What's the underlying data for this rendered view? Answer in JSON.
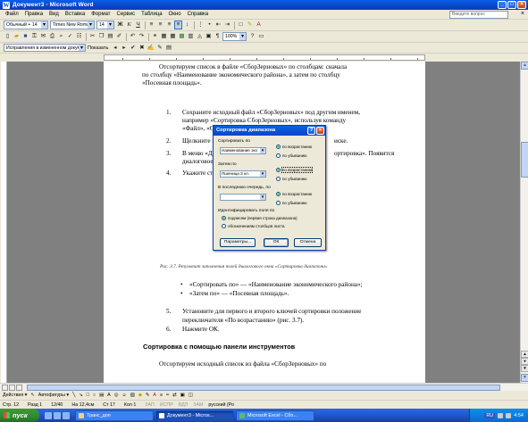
{
  "window": {
    "title": "Документ3 - Microsoft Word",
    "app_icon": "W",
    "minimize": "_",
    "maximize": "□",
    "close": "×"
  },
  "menu": {
    "items": [
      "Файл",
      "Правка",
      "Вид",
      "Вставка",
      "Формат",
      "Сервис",
      "Таблица",
      "Окно",
      "Справка"
    ],
    "help_placeholder": "Введите вопрос",
    "doc_close": "×"
  },
  "toolbar_format": {
    "style": "Обычный + 14",
    "font": "Times New Roman",
    "size": "14",
    "bold": "Ж",
    "italic": "К",
    "underline": "Ч",
    "zoom": "100%"
  },
  "toolbar_review": {
    "mode": "Исправления в измененном документе",
    "show": "Показать"
  },
  "document": {
    "p1_line1": "Отсортируем список в файле «СборЗерновых» по столбцам: сначала",
    "p1_line2": "по столбцу «Наименование экономического района», а затем по столбцу",
    "p1_line3": "«Посевная площадь».",
    "item1_num": "1.",
    "item1_line1": "Сохраните исходный файл «СборЗерновых» под другим именем,",
    "item1_line2": "например «Сортировка СборЗерновых», используя команду",
    "item1_line3": "«Файл», «Со",
    "item2_num": "2.",
    "item2_text": "Щелкните по",
    "item2_tail": "иске.",
    "item3_num": "3.",
    "item3_line1": "В меню «Д",
    "item3_tail": "ортировка». Появится",
    "item3_line2": "диалоговое о",
    "item4_num": "4.",
    "item4_text": "Укажите столб",
    "caption": "Рис. 3.7. Результат заполнения полей диалогового окна «Сортировка диапазона»",
    "bullet1": "«Сортировать по» — «Наименование экономического района»;",
    "bullet2": "«Затем по» — «Посевная площадь».",
    "item5_num": "5.",
    "item5_line1": "Установите для первого и второго ключей сортировки положение",
    "item5_line2": "переключателя «По возрастанию» (рис. 3.7).",
    "item6_num": "6.",
    "item6_text": "Нажмите ОК.",
    "heading": "Сортировка с помощью панели инструментов",
    "p2": "Отсортируем исходный список из файла «СборЗерновых» по"
  },
  "dialog": {
    "title": "Сортировка диапазона",
    "sort_by_label": "Сортировать по",
    "sort_by_value": "Наименование эко",
    "then_by_label": "Затем по",
    "then_by_value": "Пшеница 3 кл.",
    "last_label": "В последнюю очередь, по",
    "last_value": "",
    "asc": "по возрастанию",
    "desc": "по убыванию",
    "identify_label": "Идентифицировать поля по",
    "opt_headers": "подписям (первая строка диапазона)",
    "opt_columns": "обозначениям столбцов листа",
    "btn_params": "Параметры...",
    "btn_ok": "ОК",
    "btn_cancel": "Отмена",
    "help": "?",
    "close": "×"
  },
  "drawbar": {
    "actions": "Действия ▾",
    "autoshapes": "Автофигуры ▾"
  },
  "status": {
    "page": "Стр. 12",
    "section": "Разд 1",
    "pages": "12/40",
    "at": "На 12,4см",
    "line": "Ст 17",
    "col": "Кол 1",
    "rec": "ЗАП",
    "trk": "ИСПР",
    "ext": "ВДЛ",
    "ovr": "ЗАМ",
    "lang": "русский (Ро"
  },
  "taskbar": {
    "start": "пуск",
    "tasks": [
      "Транс_доп",
      "Документ3 - Micros...",
      "Microsoft Excel - Сбо..."
    ],
    "lang": "RU",
    "clock": "4:54"
  }
}
